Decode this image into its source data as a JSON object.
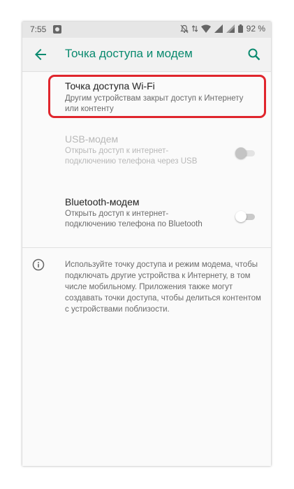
{
  "status_bar": {
    "time": "7:55",
    "battery": "92 %",
    "icons": [
      "notification-icon",
      "mute-icon",
      "wifi-icon",
      "signal-icon",
      "battery-icon"
    ]
  },
  "app_bar": {
    "title": "Точка доступа и модем",
    "back_icon": "arrow-back-icon",
    "search_icon": "search-icon",
    "accent_color": "#0a8a6f"
  },
  "items": [
    {
      "title": "Точка доступа Wi-Fi",
      "subtitle": "Другим устройствам закрыт доступ к Интернету или контенту",
      "enabled": true,
      "highlighted": true
    },
    {
      "title": "USB-модем",
      "subtitle": "Открыть доступ к интернет-подключению телефона через USB",
      "enabled": false,
      "toggle_on": false
    },
    {
      "title": "Bluetooth-модем",
      "subtitle": "Открыть доступ к интернет-подключению телефона по Bluetooth",
      "enabled": true,
      "toggle_on": false
    }
  ],
  "info": {
    "icon": "info-icon",
    "text": "Используйте точку доступа и режим модема, чтобы подключать другие устройства к Интернету, в том числе мобильному. Приложения также могут создавать точки доступа, чтобы делиться контентом с устройствами поблизости."
  },
  "highlight_color": "#e0262d"
}
